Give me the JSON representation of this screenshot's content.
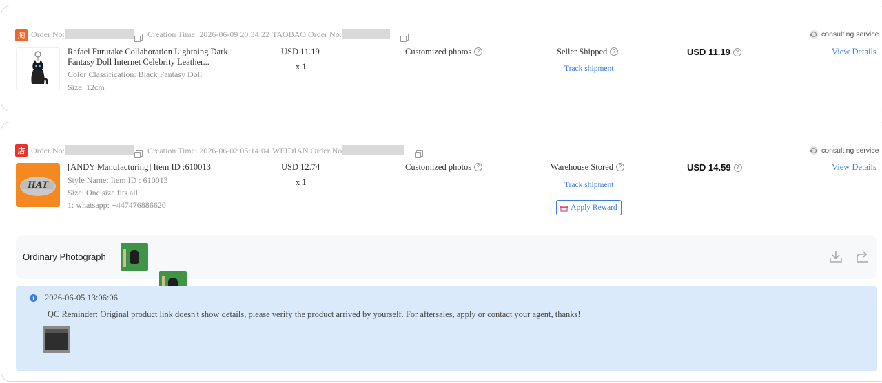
{
  "orders": [
    {
      "platform_badge": "淘",
      "platform_color": "#f0652a",
      "order_no_label": "Order No:",
      "creation_time_label": "Creation Time: 2026-06-09 20:34:22",
      "platform_order_label": "TAOBAO Order No:",
      "consult_label": "consulting service",
      "title": "Rafael Furutake Collaboration Lightning Dark Fantasy Doll Internet Celebrity Leather...",
      "attr1": "Color Classification:  Black Fantasy Doll",
      "attr2": "Size:  12cm",
      "unit_price": "USD 11.19",
      "quantity": "x 1",
      "photos_label": "Customized photos",
      "status": "Seller Shipped",
      "track_label": "Track shipment",
      "total": "USD 11.19",
      "view_details": "View Details"
    },
    {
      "platform_badge": "店",
      "platform_color": "#e8322b",
      "order_no_label": "Order No:",
      "creation_time_label": "Creation Time: 2026-06-02 05:14:04",
      "platform_order_label": "WEIDIAN Order No:",
      "consult_label": "consulting service",
      "title": "[ANDY Manufacturing] Item ID :610013",
      "attr1": "Style Name:  Item ID :  610013",
      "attr2": "Size:  One size fits all",
      "attr3": "1:  whatsapp:  +447476886620",
      "thumb_text": "HAT",
      "unit_price": "USD 12.74",
      "quantity": "x 1",
      "photos_label": "Customized photos",
      "status": "Warehouse Stored",
      "track_label": "Track shipment",
      "reward_label": "Apply Reward",
      "total": "USD 14.59",
      "view_details": "View Details",
      "photograph_label": "Ordinary Photograph",
      "qc": {
        "timestamp": "2026-06-05 13:06:06",
        "message": "QC Reminder: Original product link doesn't show details, please verify the product arrived by yourself. For aftersales, apply or contact your agent, thanks!"
      }
    }
  ],
  "icons": [
    "copy-icon",
    "question-icon",
    "headset-icon",
    "gift-icon",
    "download-icon",
    "share-icon",
    "info-icon"
  ]
}
